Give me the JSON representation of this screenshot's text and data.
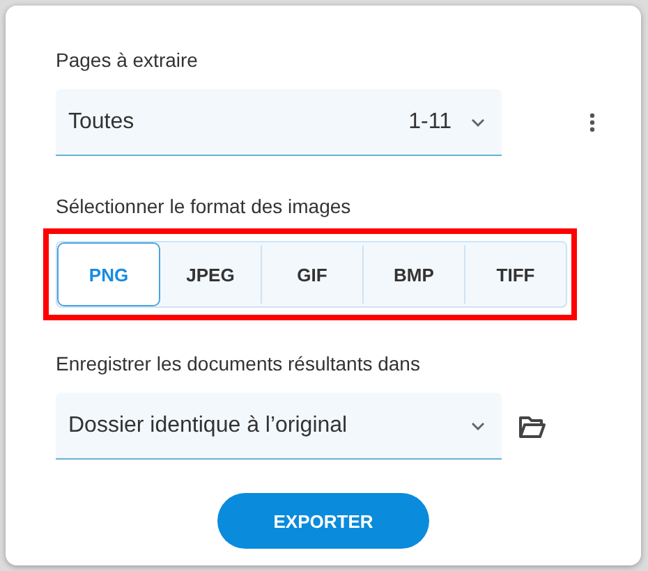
{
  "pages": {
    "label": "Pages à extraire",
    "value": "Toutes",
    "range": "1-11"
  },
  "format": {
    "label": "Sélectionner le format des images",
    "highlighted": true,
    "options": [
      {
        "label": "PNG",
        "selected": true
      },
      {
        "label": "JPEG",
        "selected": false
      },
      {
        "label": "GIF",
        "selected": false
      },
      {
        "label": "BMP",
        "selected": false
      },
      {
        "label": "TIFF",
        "selected": false
      }
    ]
  },
  "destination": {
    "label": "Enregistrer les documents résultants dans",
    "value": "Dossier identique à l’original"
  },
  "export_button": "EXPORTER"
}
